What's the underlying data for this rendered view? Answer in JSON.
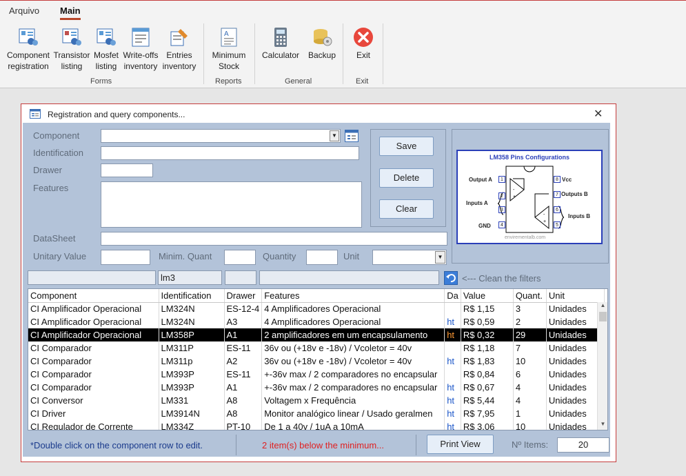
{
  "ribbon": {
    "tabs": [
      {
        "label": "Arquivo"
      },
      {
        "label": "Main"
      }
    ],
    "buttons": {
      "component_registration": "Component\nregistration",
      "transistor_listing": "Transistor\nlisting",
      "mosfet_listing": "Mosfet\nlisting",
      "writeoffs_inventory": "Write-offs\ninventory",
      "entries_inventory": "Entries\ninventory",
      "minimum_stock": "Minimum\nStock",
      "calculator": "Calculator",
      "backup": "Backup",
      "exit": "Exit"
    },
    "groups": {
      "forms": "Forms",
      "reports": "Reports",
      "general": "General",
      "exit": "Exit"
    }
  },
  "window": {
    "title": "Registration and query components...",
    "close": "✕"
  },
  "form": {
    "component_label": "Component",
    "identification_label": "Identification",
    "drawer_label": "Drawer",
    "features_label": "Features",
    "datasheet_label": "DataSheet",
    "unitary_value_label": "Unitary Value",
    "minim_quant_label": "Minim. Quant",
    "quantity_label": "Quantity",
    "unit_label": "Unit"
  },
  "actions": {
    "save": "Save",
    "delete": "Delete",
    "clear": "Clear"
  },
  "diagram": {
    "title": "LM358 Pins Configurations",
    "output_a": "Output A",
    "inputs_a": "Inputs A",
    "gnd": "GND",
    "vcc": "Vcc",
    "outputs_b": "Outputs B",
    "inputs_b": "Inputs B",
    "watermark": "envirementalb.com",
    "pins_left": [
      "1",
      "2",
      "3",
      "4"
    ],
    "pins_right": [
      "8",
      "7",
      "6",
      "5"
    ]
  },
  "filter": {
    "identification_value": "lm3",
    "clean_label": "<--- Clean the filters"
  },
  "table": {
    "columns": [
      "Component",
      "Identification",
      "Drawer",
      "Features",
      "Da",
      "Value",
      "Quant.",
      "Unit"
    ],
    "rows": [
      [
        "CI Amplificador Operacional",
        "LM324N",
        "ES-12-4",
        "4 Amplificadores Operacional",
        "",
        "R$ 1,15",
        "3",
        "Unidades"
      ],
      [
        "CI Amplificador Operacional",
        "LM324N",
        "A3",
        "4 Amplificadores Operacional",
        "ht",
        "R$ 0,59",
        "2",
        "Unidades"
      ],
      [
        "CI Amplificador Operacional",
        "LM358P",
        "A1",
        "2 amplificadores em um encapsulamento",
        "ht",
        "R$ 0,32",
        "29",
        "Unidades"
      ],
      [
        "CI Comparador",
        "LM311P",
        "ES-11",
        "36v ou (+18v e -18v) / Vcoletor = 40v",
        "",
        "R$ 1,18",
        "7",
        "Unidades"
      ],
      [
        "CI Comparador",
        "LM311p",
        "A2",
        "36v ou (+18v e -18v) / Vcoletor = 40v",
        "ht",
        "R$ 1,83",
        "10",
        "Unidades"
      ],
      [
        "CI Comparador",
        "LM393P",
        "ES-11",
        "+-36v max / 2 comparadores no encapsular",
        "",
        "R$ 0,84",
        "6",
        "Unidades"
      ],
      [
        "CI Comparador",
        "LM393P",
        "A1",
        "+-36v max / 2 comparadores no encapsular",
        "ht",
        "R$ 0,67",
        "4",
        "Unidades"
      ],
      [
        "CI Conversor",
        "LM331",
        "A8",
        "Voltagem x Frequência",
        "ht",
        "R$ 5,44",
        "4",
        "Unidades"
      ],
      [
        "CI Driver",
        "LM3914N",
        "A8",
        "Monitor analógico linear /  Usado geralmen",
        "ht",
        "R$ 7,95",
        "1",
        "Unidades"
      ],
      [
        "CI Regulador de Corrente",
        "LM334Z",
        "PT-10",
        "De 1 a 40v / 1uA a 10mA",
        "ht",
        "R$ 3,06",
        "10",
        "Unidades"
      ]
    ],
    "selected_row": 2
  },
  "footer": {
    "hint": "*Double click on the component row to edit.",
    "warning": "2 item(s) below the minimum...",
    "print": "Print View",
    "items_label": "Nº Items:",
    "items_value": "20"
  },
  "colors": {
    "accent": "#b7472a",
    "panel": "#b3c3d9",
    "warning": "#e02020",
    "hint": "#1a3a8c"
  }
}
